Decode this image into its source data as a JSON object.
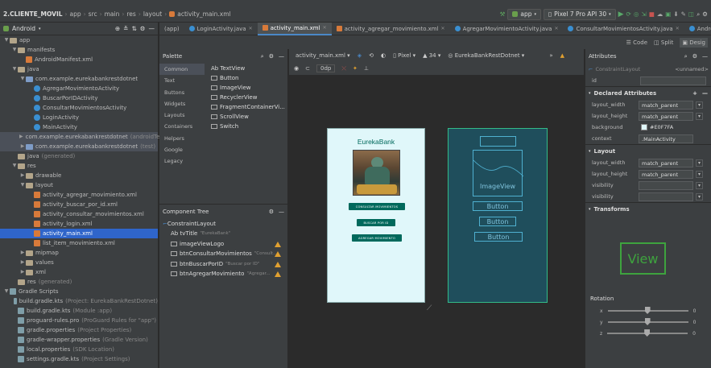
{
  "nav": {
    "project": "2.CLIENTE_MOVIL",
    "crumbs": [
      "app",
      "src",
      "main",
      "res",
      "layout",
      "activity_main.xml"
    ],
    "run_config": "app",
    "device": "Pixel 7 Pro API 30"
  },
  "project_panel": {
    "view_mode": "Android",
    "tree": [
      {
        "label": "app",
        "lvl": 0,
        "arrow": "v",
        "icon": "fold"
      },
      {
        "label": "manifests",
        "lvl": 1,
        "arrow": "v",
        "icon": "fold"
      },
      {
        "label": "AndroidManifest.xml",
        "lvl": 2,
        "arrow": "",
        "icon": "xm"
      },
      {
        "label": "java",
        "lvl": 1,
        "arrow": "v",
        "icon": "fold"
      },
      {
        "label": "com.example.eurekabankrestdotnet",
        "lvl": 2,
        "arrow": "v",
        "icon": "foldb"
      },
      {
        "label": "AgregarMovimientoActivity",
        "lvl": 3,
        "arrow": "",
        "icon": "jc"
      },
      {
        "label": "BuscarPorIDActivity",
        "lvl": 3,
        "arrow": "",
        "icon": "jc"
      },
      {
        "label": "ConsultarMovimientosActivity",
        "lvl": 3,
        "arrow": "",
        "icon": "jc"
      },
      {
        "label": "LoginActivity",
        "lvl": 3,
        "arrow": "",
        "icon": "jc"
      },
      {
        "label": "MainActivity",
        "lvl": 3,
        "arrow": "",
        "icon": "jc"
      },
      {
        "label": "com.example.eurekabankrestdotnet",
        "hint": "(androidTest)",
        "lvl": 2,
        "arrow": ">",
        "icon": "foldb",
        "hl": true
      },
      {
        "label": "com.example.eurekabankrestdotnet",
        "hint": "(test)",
        "lvl": 2,
        "arrow": ">",
        "icon": "foldb",
        "hl": true
      },
      {
        "label": "java",
        "hint": "(generated)",
        "lvl": 1,
        "arrow": "",
        "icon": "fold"
      },
      {
        "label": "res",
        "lvl": 1,
        "arrow": "v",
        "icon": "fold"
      },
      {
        "label": "drawable",
        "lvl": 2,
        "arrow": ">",
        "icon": "fold"
      },
      {
        "label": "layout",
        "lvl": 2,
        "arrow": "v",
        "icon": "fold"
      },
      {
        "label": "activity_agregar_movimiento.xml",
        "lvl": 3,
        "arrow": "",
        "icon": "xm"
      },
      {
        "label": "activity_buscar_por_id.xml",
        "lvl": 3,
        "arrow": "",
        "icon": "xm"
      },
      {
        "label": "activity_consultar_movimientos.xml",
        "lvl": 3,
        "arrow": "",
        "icon": "xm"
      },
      {
        "label": "activity_login.xml",
        "lvl": 3,
        "arrow": "",
        "icon": "xm"
      },
      {
        "label": "activity_main.xml",
        "lvl": 3,
        "arrow": "",
        "icon": "xm",
        "sel": true
      },
      {
        "label": "list_item_movimiento.xml",
        "lvl": 3,
        "arrow": "",
        "icon": "xm"
      },
      {
        "label": "mipmap",
        "lvl": 2,
        "arrow": ">",
        "icon": "fold"
      },
      {
        "label": "values",
        "lvl": 2,
        "arrow": ">",
        "icon": "fold"
      },
      {
        "label": "xml",
        "lvl": 2,
        "arrow": ">",
        "icon": "fold"
      },
      {
        "label": "res",
        "hint": "(generated)",
        "lvl": 1,
        "arrow": "",
        "icon": "fold"
      },
      {
        "label": "Gradle Scripts",
        "lvl": 0,
        "arrow": "v",
        "icon": "gr"
      },
      {
        "label": "build.gradle.kts",
        "hint": "(Project: EurekaBankRestDotnet)",
        "lvl": 1,
        "arrow": "",
        "icon": "gr"
      },
      {
        "label": "build.gradle.kts",
        "hint": "(Module :app)",
        "lvl": 1,
        "arrow": "",
        "icon": "gr"
      },
      {
        "label": "proguard-rules.pro",
        "hint": "(ProGuard Rules for \"app\")",
        "lvl": 1,
        "arrow": "",
        "icon": "gr"
      },
      {
        "label": "gradle.properties",
        "hint": "(Project Properties)",
        "lvl": 1,
        "arrow": "",
        "icon": "gr"
      },
      {
        "label": "gradle-wrapper.properties",
        "hint": "(Gradle Version)",
        "lvl": 1,
        "arrow": "",
        "icon": "gr"
      },
      {
        "label": "local.properties",
        "hint": "(SDK Location)",
        "lvl": 1,
        "arrow": "",
        "icon": "gr"
      },
      {
        "label": "settings.gradle.kts",
        "hint": "(Project Settings)",
        "lvl": 1,
        "arrow": "",
        "icon": "gr"
      }
    ]
  },
  "tabs": [
    {
      "label": "(app)"
    },
    {
      "label": "LoginActivity.java"
    },
    {
      "label": "activity_main.xml",
      "active": true
    },
    {
      "label": "activity_agregar_movimiento.xml"
    },
    {
      "label": "AgregarMovimientoActivity.java"
    },
    {
      "label": "ConsultarMovimientosActivity.java"
    },
    {
      "label": "AndroidMa"
    }
  ],
  "view_modes": {
    "code": "Code",
    "split": "Split",
    "design": "Desig"
  },
  "palette": {
    "title": "Palette",
    "categories": [
      "Common",
      "Text",
      "Buttons",
      "Widgets",
      "Layouts",
      "Containers",
      "Helpers",
      "Google",
      "Legacy"
    ],
    "items": [
      "Ab TextView",
      "Button",
      "ImageView",
      "RecyclerView",
      "FragmentContainerVi...",
      "ScrollView",
      "Switch"
    ]
  },
  "component_tree": {
    "title": "Component Tree",
    "root": "ConstraintLayout",
    "items": [
      {
        "label": "Ab tvTitle",
        "hint": "\"EurekaBank\"",
        "warn": false
      },
      {
        "label": "imageViewLogo",
        "hint": "",
        "warn": true
      },
      {
        "label": "btnConsultarMovimientos",
        "hint": "\"Consult...",
        "warn": true
      },
      {
        "label": "btnBuscarPorID",
        "hint": "\"Buscar por ID\"",
        "warn": true
      },
      {
        "label": "btnAgregarMovimiento",
        "hint": "\"Agregar...",
        "warn": true
      }
    ]
  },
  "design_toolbar": {
    "file": "activity_main.xml",
    "device": "Pixel",
    "api": "34",
    "theme": "EurekaBankRestDotnet",
    "margin": "0dp"
  },
  "preview": {
    "title": "EurekaBank",
    "btn1": "CONSULTAR MOVIMIENTOS",
    "btn2": "BUSCAR POR ID",
    "btn3": "AGREGAR MOVIMIENTO"
  },
  "blueprint": {
    "image": "ImageView",
    "b1": "Button",
    "b2": "Button",
    "b3": "Button"
  },
  "attributes": {
    "title": "Attributes",
    "component": "ConstraintLayout",
    "unnamed": "<unnamed>",
    "id_label": "id",
    "declared": "Declared Attributes",
    "rows": [
      {
        "k": "layout_width",
        "v": "match_parent"
      },
      {
        "k": "layout_height",
        "v": "match_parent"
      },
      {
        "k": "background",
        "v": "#E0F7FA"
      },
      {
        "k": "context",
        "v": ".MainActivity"
      }
    ],
    "layout": "Layout",
    "lrows": [
      {
        "k": "layout_width",
        "v": "match_parent"
      },
      {
        "k": "layout_height",
        "v": "match_parent"
      },
      {
        "k": "visibility",
        "v": ""
      },
      {
        "k": "visibility",
        "v": ""
      }
    ],
    "transforms": "Transforms",
    "view_label": "View",
    "rotation": "Rotation",
    "axes": [
      "x",
      "y",
      "z"
    ],
    "zero": "0"
  }
}
